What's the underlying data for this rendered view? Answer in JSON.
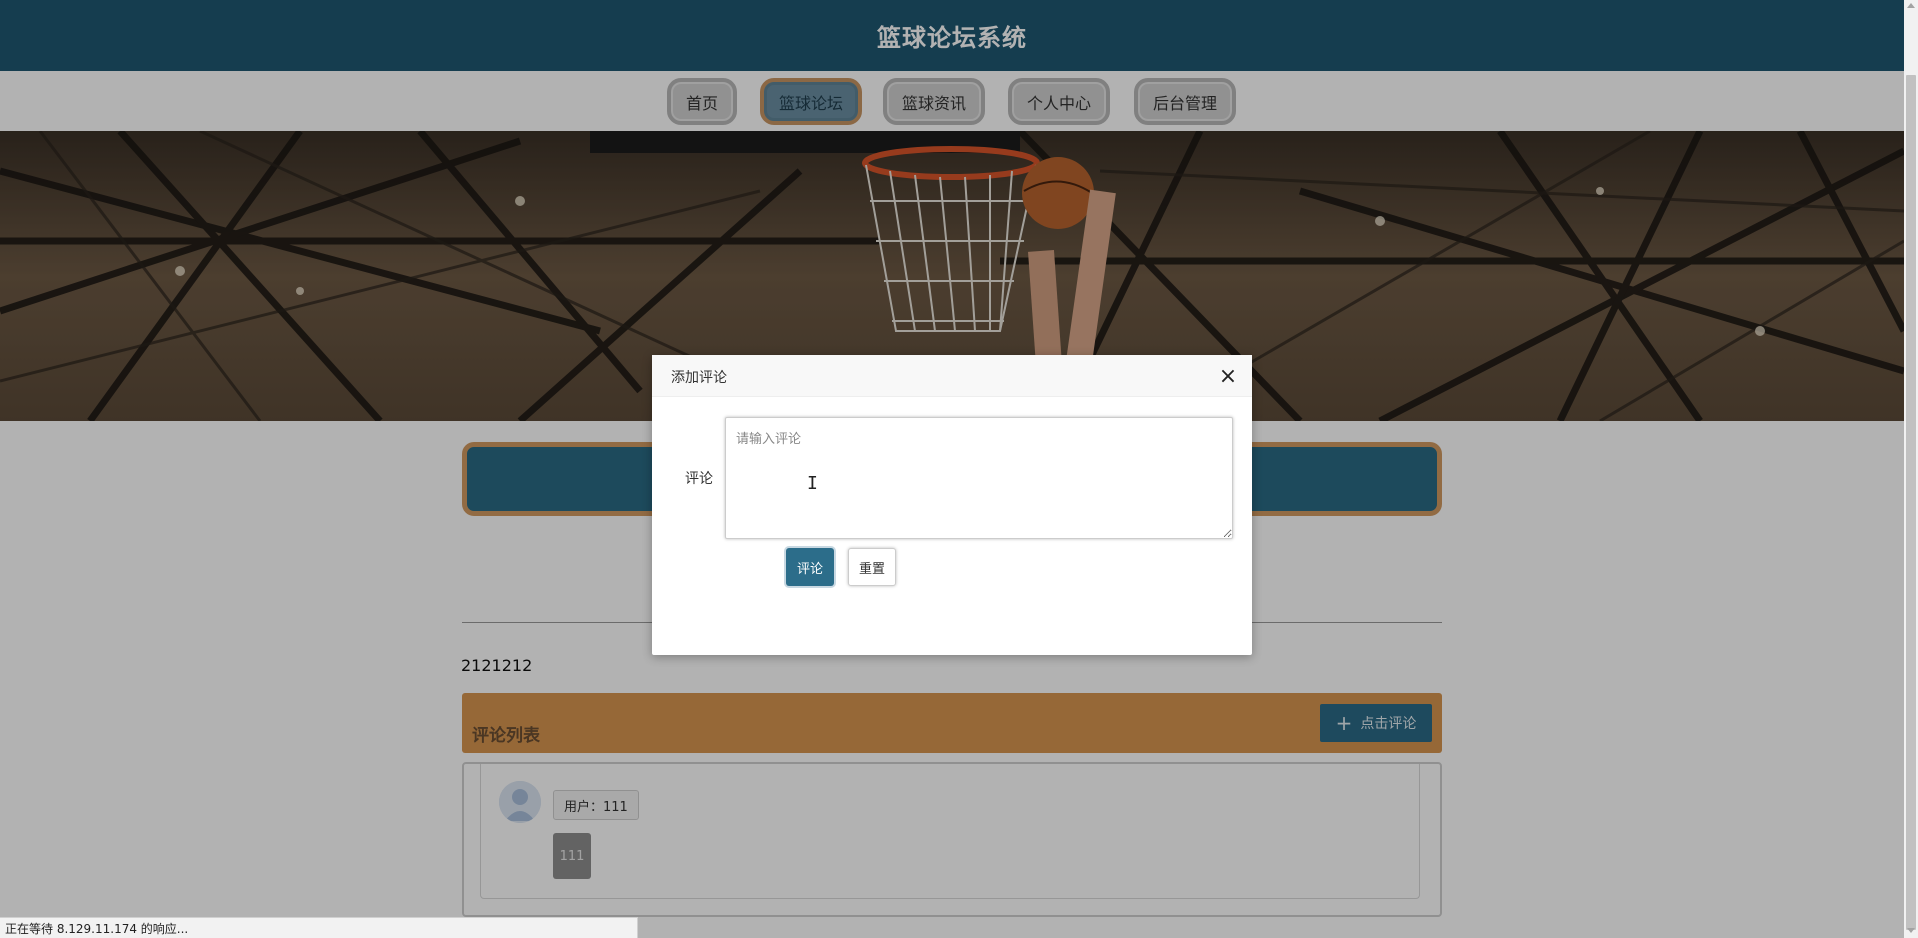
{
  "header": {
    "title": "篮球论坛系统"
  },
  "nav": {
    "items": [
      {
        "label": "首页"
      },
      {
        "label": "篮球论坛"
      },
      {
        "label": "篮球资讯"
      },
      {
        "label": "个人中心"
      },
      {
        "label": "后台管理"
      }
    ],
    "active_index": 1
  },
  "post": {
    "body": "2121212"
  },
  "comments": {
    "section_title": "评论列表",
    "add_button_label": "点击评论",
    "items": [
      {
        "user_label": "用户：111",
        "content": "111"
      }
    ]
  },
  "modal": {
    "title": "添加评论",
    "field_label": "评论",
    "textarea_placeholder": "请输入评论",
    "textarea_value": "",
    "submit_label": "评论",
    "reset_label": "重置"
  },
  "status_bar": {
    "text": "正在等待 8.129.11.174 的响应..."
  },
  "colors": {
    "header_bg": "#1f5872",
    "accent_orange": "#d7954f",
    "button_blue": "#2c6d8a"
  },
  "icons": {
    "close": "close-icon",
    "plus": "plus-icon",
    "avatar": "user-avatar-icon"
  }
}
